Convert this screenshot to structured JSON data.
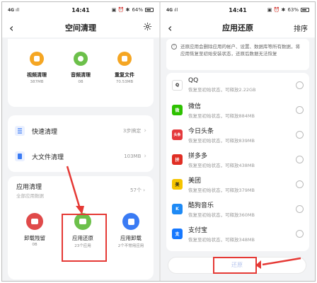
{
  "left": {
    "status": {
      "network": "4G",
      "signal": "ıll",
      "time": "14:41",
      "indicators": "▣ ⏰ ✱",
      "battery": "64%"
    },
    "header": {
      "title": "空间清理"
    },
    "top_items": [
      {
        "label": "视频清理",
        "value": "387MB"
      },
      {
        "label": "音频清理",
        "value": "0B"
      },
      {
        "label": "重复文件",
        "value": "70.53MB"
      }
    ],
    "rows": [
      {
        "label": "快速清理",
        "value": "3步搞定"
      },
      {
        "label": "大文件清理",
        "value": "103MB"
      }
    ],
    "app_clean": {
      "title": "应用清理",
      "subtitle": "全部应用数据",
      "value": "57个",
      "items": [
        {
          "label": "卸载残留",
          "value": "0B"
        },
        {
          "label": "应用还原",
          "value": "23个应用"
        },
        {
          "label": "应用卸载",
          "value": "2个不常用应用"
        }
      ]
    },
    "colors": {
      "video": "#f5a623",
      "audio": "#6cc04a",
      "dup": "#f5a623",
      "residue": "#e04a4a",
      "restore": "#6cc04a",
      "uninstall": "#3a7bf4",
      "accent_red": "#e53935"
    }
  },
  "right": {
    "status": {
      "network": "4G",
      "signal": "ıll",
      "time": "14:41",
      "indicators": "▣ ⏰ ✱",
      "battery": "63%"
    },
    "header": {
      "title": "应用还原",
      "action": "排序"
    },
    "notice": "还原应用会删除应用的帐户、设置、数据库等所有数据，将应用恢复至初始安装状态，还原后数据无法恢复",
    "apps": [
      {
        "name": "QQ",
        "desc": "恢复至初始状态，可释放2.22GB",
        "icon": "qq-icon",
        "logo": "Q",
        "color": "#1a1a1a"
      },
      {
        "name": "微信",
        "desc": "恢复至初始状态，可释放884MB",
        "icon": "wechat-icon",
        "logo": "微",
        "color": "#2dc100"
      },
      {
        "name": "今日头条",
        "desc": "恢复至初始状态，可释放839MB",
        "icon": "toutiao-icon",
        "logo": "头条",
        "color": "#e4393c"
      },
      {
        "name": "拼多多",
        "desc": "恢复至初始状态，可释放438MB",
        "icon": "pinduoduo-icon",
        "logo": "拼",
        "color": "#e02e24"
      },
      {
        "name": "美团",
        "desc": "恢复至初始状态，可释放379MB",
        "icon": "meituan-icon",
        "logo": "美",
        "color": "#f5c400"
      },
      {
        "name": "酷狗音乐",
        "desc": "恢复至初始状态，可释放360MB",
        "icon": "kugou-icon",
        "logo": "K",
        "color": "#1e8af5"
      },
      {
        "name": "支付宝",
        "desc": "恢复至初始状态，可释放348MB",
        "icon": "alipay-icon",
        "logo": "支",
        "color": "#1678ff"
      }
    ],
    "restore_button": "还原"
  }
}
